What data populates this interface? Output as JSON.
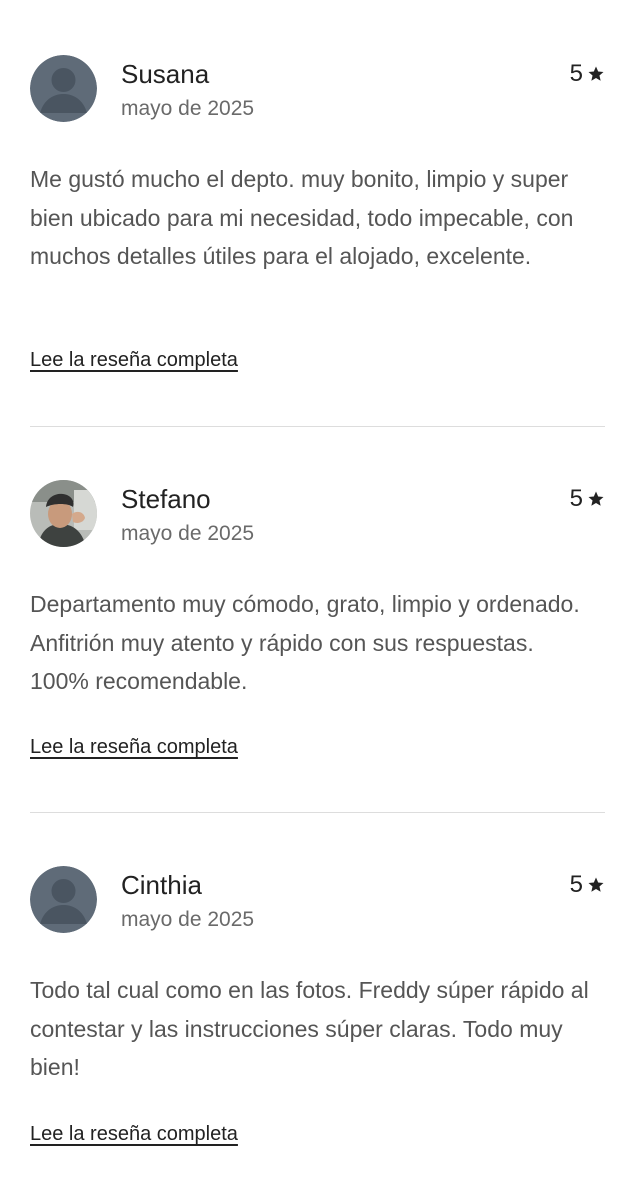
{
  "reviews": [
    {
      "name": "Susana",
      "date": "mayo de 2025",
      "rating": "5",
      "avatar": "default-avatar",
      "text": "Me gustó mucho el depto. muy bonito, limpio y super bien ubicado para mi necesidad, todo impecable, con muchos detalles útiles para el alojado, excelente.",
      "link": "Lee la reseña completa"
    },
    {
      "name": "Stefano",
      "date": "mayo de 2025",
      "rating": "5",
      "avatar": "photo-avatar",
      "text": "Departamento muy cómodo, grato, limpio y ordenado. Anfitrión muy atento y rápido con sus respuestas. 100% recomendable.",
      "link": "Lee la reseña completa"
    },
    {
      "name": "Cinthia",
      "date": "mayo de 2025",
      "rating": "5",
      "avatar": "default-avatar",
      "text": "Todo tal cual como en las fotos. Freddy súper rápido al contestar y las instrucciones súper claras. Todo muy bien!",
      "link": "Lee la reseña completa"
    }
  ],
  "colors": {
    "text": "#222222",
    "secondary": "#6a6a6a",
    "body_text": "#555555",
    "divider": "#dddddd",
    "avatar_bg": "#5f6b78",
    "avatar_fg": "#4a5561"
  },
  "icons": {
    "rating": "star-icon"
  }
}
